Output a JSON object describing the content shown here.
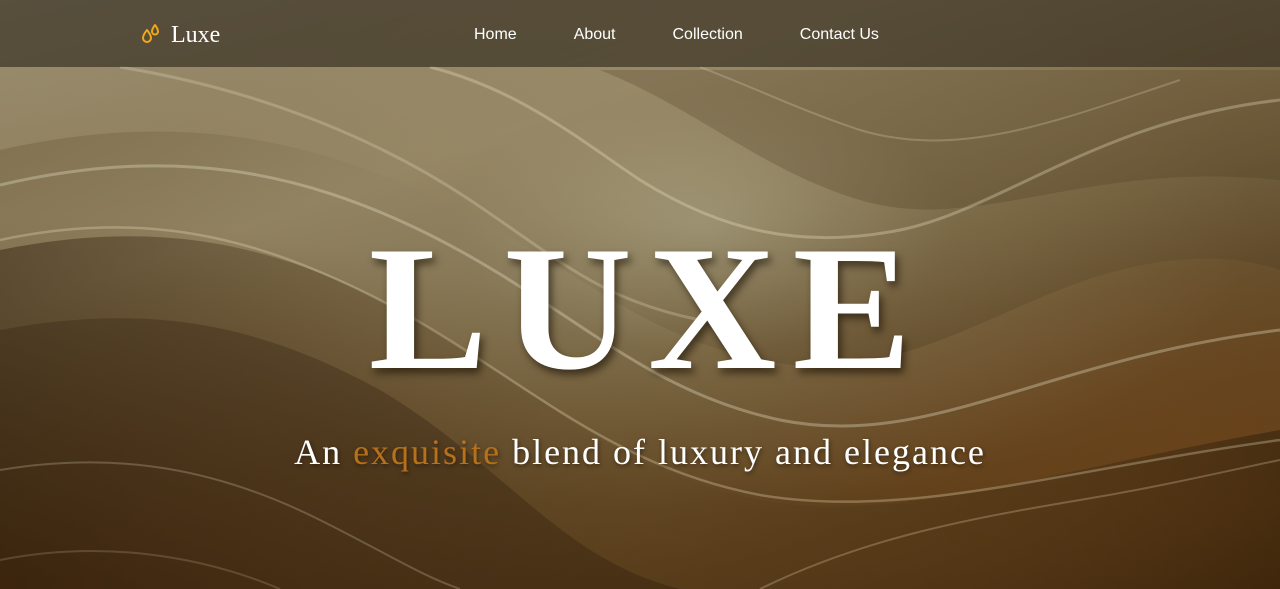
{
  "brand": {
    "name": "Luxe",
    "icon": "droplets-icon",
    "icon_color": "#f0a818"
  },
  "nav": {
    "items": [
      {
        "label": "Home"
      },
      {
        "label": "About"
      },
      {
        "label": "Collection"
      },
      {
        "label": "Contact Us"
      }
    ]
  },
  "hero": {
    "title": "LUXE",
    "tagline_before": "An ",
    "tagline_accent": "exquisite",
    "tagline_after": " blend of luxury and elegance",
    "accent_color": "#b5711c"
  }
}
